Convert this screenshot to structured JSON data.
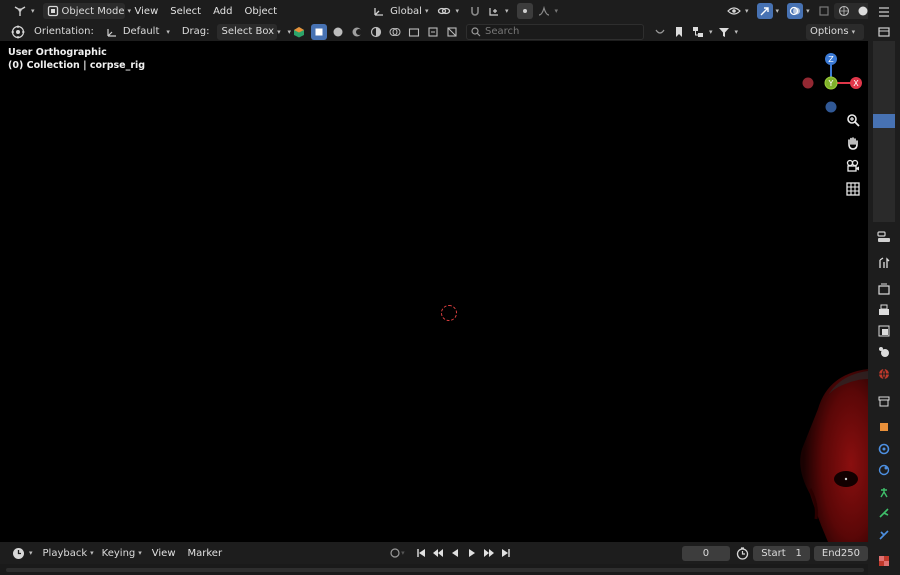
{
  "header": {
    "mode": "Object Mode",
    "menus": [
      "View",
      "Select",
      "Add",
      "Object"
    ],
    "transform_orientation": "Global"
  },
  "toolbar": {
    "orientation_label": "Orientation:",
    "orientation_value": "Default",
    "drag_label": "Drag:",
    "drag_value": "Select Box",
    "search_placeholder": "Search",
    "options_label": "Options"
  },
  "viewport": {
    "view_name": "User Orthographic",
    "collection_prefix": "(0) Collection",
    "active_object": "corpse_rig",
    "gizmo": {
      "z_label": "Z",
      "y_label": "Y",
      "x_label": "X"
    }
  },
  "timeline": {
    "menus": [
      "Playback",
      "Keying",
      "View",
      "Marker"
    ],
    "current_frame": "0",
    "start_label": "Start",
    "start_value": "1",
    "end_label": "End",
    "end_value": "250"
  },
  "colors": {
    "x_axis": "#e0374a",
    "y_axis": "#7fb02b",
    "z_axis": "#3b7ad6",
    "accent": "#4772b3"
  }
}
